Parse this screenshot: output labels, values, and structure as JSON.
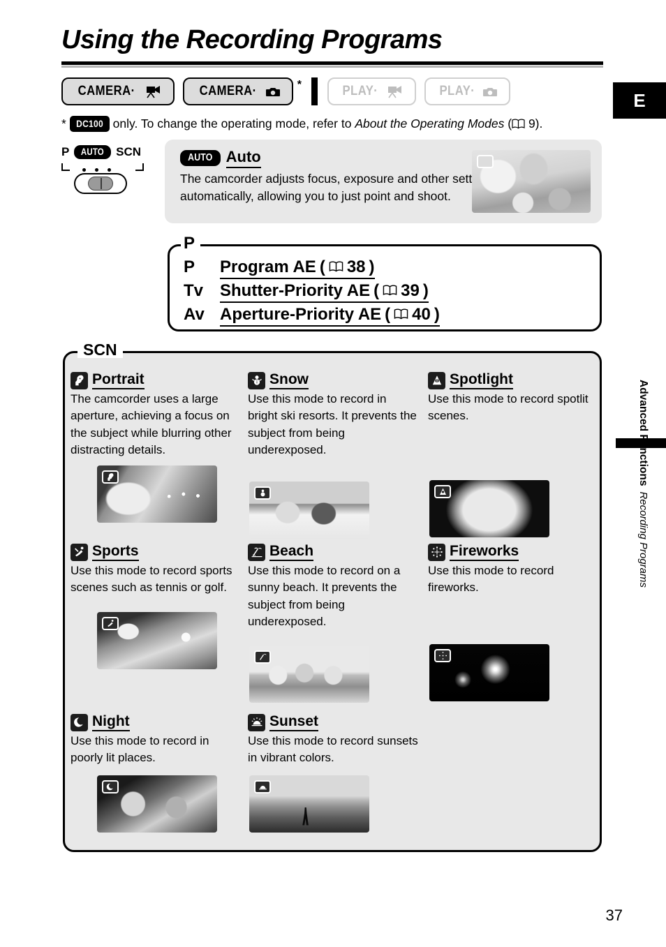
{
  "page": {
    "title": "Using the Recording Programs",
    "page_number": "37",
    "language_tab": "E"
  },
  "modes": {
    "buttons": [
      {
        "label": "CAMERA",
        "separator": "·",
        "icon": "movie-camera-icon",
        "state": "active",
        "asterisk": false
      },
      {
        "label": "CAMERA",
        "separator": "·",
        "icon": "still-camera-icon",
        "state": "active",
        "asterisk": true
      },
      {
        "label": "PLAY",
        "separator": "·",
        "icon": "movie-camera-icon",
        "state": "inactive",
        "asterisk": false
      },
      {
        "label": "PLAY",
        "separator": "·",
        "icon": "still-camera-icon",
        "state": "inactive",
        "asterisk": false
      }
    ]
  },
  "footnote": {
    "asterisk": "*",
    "model_badge": "DC100",
    "text_before": "only. To change the operating mode, refer to",
    "italic_ref": "About the Operating Modes",
    "open_paren": "(",
    "page_ref": "9",
    "close_paren": ").",
    "book_icon": "book-icon"
  },
  "dial": {
    "labels": {
      "left": "P",
      "middle": "AUTO",
      "right": "SCN"
    },
    "dots": 3,
    "switch_icon": "slider-switch-icon"
  },
  "auto_section": {
    "badge": "AUTO",
    "title": "Auto",
    "description": "The camcorder adjusts focus, exposure and other settings automatically, allowing you to just point and shoot.",
    "photo": {
      "name": "family-on-beach-photo",
      "badge_icon": "auto-mode-badge-icon"
    }
  },
  "p_section": {
    "legend": "P",
    "rows": [
      {
        "key": "P",
        "label": "Program AE",
        "open": "(",
        "book_icon": "book-icon",
        "page": "38",
        "close": ")"
      },
      {
        "key": "Tv",
        "label": "Shutter-Priority AE",
        "open": "(",
        "book_icon": "book-icon",
        "page": "39",
        "close": ")"
      },
      {
        "key": "Av",
        "label": "Aperture-Priority AE",
        "open": "(",
        "book_icon": "book-icon",
        "page": "40",
        "close": ")"
      }
    ]
  },
  "scn_section": {
    "legend": "SCN",
    "scenes": [
      {
        "id": "portrait",
        "icon": "portrait-mode-icon",
        "title": "Portrait",
        "description": "The camcorder uses a large aperture, achieving a focus on the subject while blurring other distracting details.",
        "photo": "girl-with-birthday-candles-photo"
      },
      {
        "id": "snow",
        "icon": "snow-mode-icon",
        "title": "Snow",
        "description": "Use this mode to record in bright ski resorts. It prevents the subject from being underexposed.",
        "photo": "two-people-in-snow-photo"
      },
      {
        "id": "spotlight",
        "icon": "spotlight-mode-icon",
        "title": "Spotlight",
        "description": "Use this mode to record spotlit scenes.",
        "photo": "spotlit-dancer-photo"
      },
      {
        "id": "sports",
        "icon": "sports-mode-icon",
        "title": "Sports",
        "description": "Use this mode to record sports scenes such as tennis or golf.",
        "photo": "tennis-player-photo"
      },
      {
        "id": "beach",
        "icon": "beach-mode-icon",
        "title": "Beach",
        "description": "Use this mode to record on a sunny beach. It prevents the subject from being underexposed.",
        "photo": "friends-on-beach-photo"
      },
      {
        "id": "fireworks",
        "icon": "fireworks-mode-icon",
        "title": "Fireworks",
        "description": "Use this mode to record fireworks.",
        "photo": "fireworks-in-night-sky-photo"
      },
      {
        "id": "night",
        "icon": "night-mode-icon",
        "title": "Night",
        "description": "Use this mode to record in poorly lit places.",
        "photo": "people-in-dim-room-photo"
      },
      {
        "id": "sunset",
        "icon": "sunset-mode-icon",
        "title": "Sunset",
        "description": "Use this mode to record sunsets in vibrant colors.",
        "photo": "person-walking-at-sunset-photo"
      }
    ]
  },
  "sidebar": {
    "chapter": "Advanced Functions",
    "section": "Recording Programs"
  },
  "colors": {
    "panel_gray": "#e8e8e8",
    "button_fill": "#dcdcdc",
    "inactive_text": "#bdbdbd",
    "rule_gray": "#b5b5b5",
    "black": "#000000"
  }
}
